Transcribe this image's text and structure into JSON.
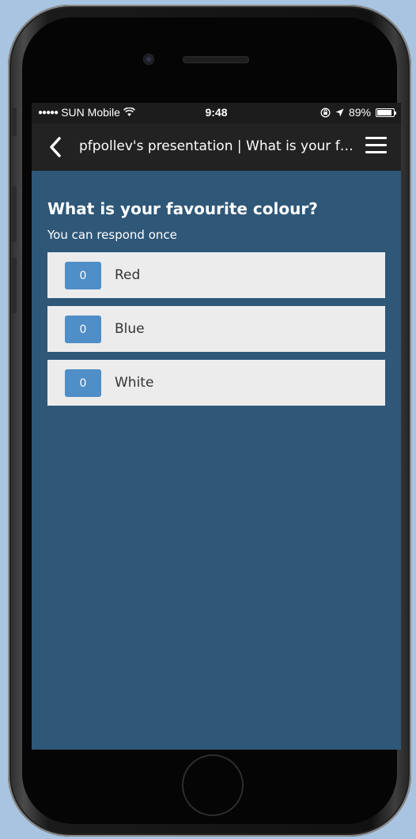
{
  "status_bar": {
    "signal_dots": "●●●●●",
    "carrier": "SUN Mobile",
    "wifi_icon": "wifi-icon",
    "time": "9:48",
    "lock_icon": "rotation-lock-icon",
    "location_icon": "location-arrow-icon",
    "battery_percent": "89%",
    "battery_level": 0.89
  },
  "nav": {
    "back_icon": "chevron-left-icon",
    "title": "pfpollev's presentation | What is your favourite colour?",
    "menu_icon": "hamburger-menu-icon"
  },
  "poll": {
    "question": "What is your favourite colour?",
    "subtitle": "You can respond once",
    "options": [
      {
        "count": "0",
        "label": "Red"
      },
      {
        "count": "0",
        "label": "Blue"
      },
      {
        "count": "0",
        "label": "White"
      }
    ]
  },
  "colors": {
    "screen_bg": "#2f5778",
    "navbar_bg": "#222222",
    "count_badge": "#4f8ec6",
    "option_bg": "#ececec"
  }
}
